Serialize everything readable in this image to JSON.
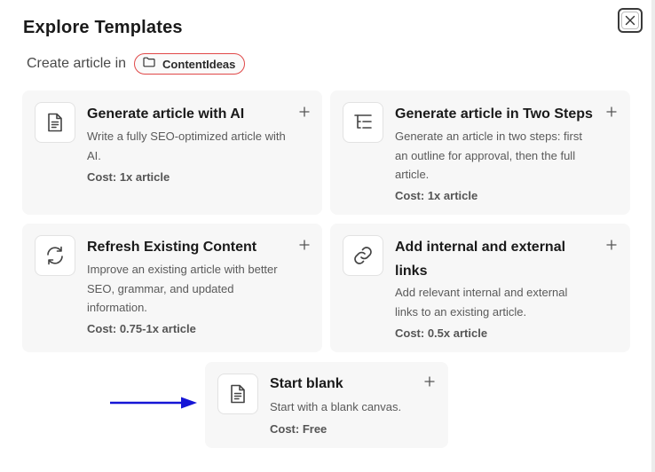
{
  "modal": {
    "title": "Explore Templates",
    "create_label": "Create article in",
    "folder_name": "ContentIdeas"
  },
  "cards": [
    {
      "title": "Generate article with AI",
      "description": "Write a fully SEO-optimized article with AI.",
      "cost": "Cost: 1x article",
      "icon": "document-icon"
    },
    {
      "title": "Generate article in Two Steps",
      "description": "Generate an article in two steps: first an outline for approval, then the full article.",
      "cost": "Cost: 1x article",
      "icon": "outline-icon"
    },
    {
      "title": "Refresh Existing Content",
      "description": "Improve an existing article with better SEO, grammar, and updated information.",
      "cost": "Cost: 0.75-1x article",
      "icon": "refresh-icon"
    },
    {
      "title": "Add internal and external links",
      "description": "Add relevant internal and external links to an existing article.",
      "cost": "Cost: 0.5x article",
      "icon": "link-icon"
    },
    {
      "title": "Start blank",
      "description": "Start with a blank canvas.",
      "cost": "Cost: Free",
      "icon": "document-icon"
    }
  ],
  "colors": {
    "folder_chip_border": "#e04848",
    "arrow": "#1515d6",
    "card_bg": "#f7f7f7"
  }
}
